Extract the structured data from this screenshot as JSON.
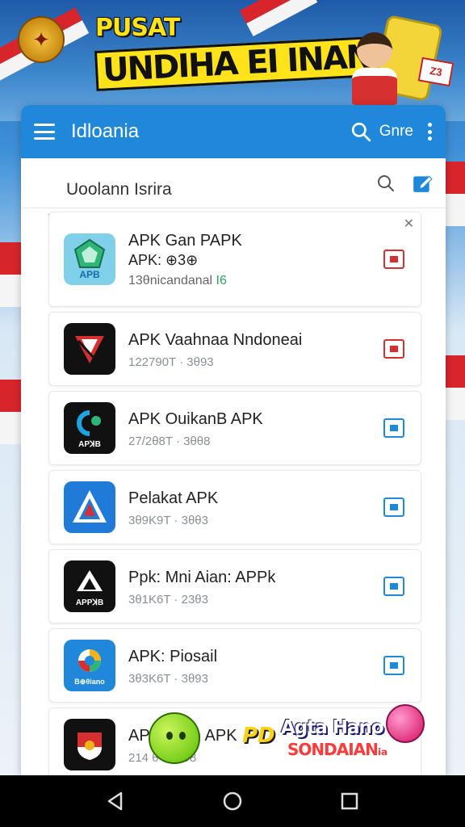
{
  "banner": {
    "title_line1": "PUSAT",
    "title_line2": "UNDIHA EI INANSIA",
    "sign_text": "Z3",
    "garuda_icon": "garuda-emblem-icon"
  },
  "appbar": {
    "title": "Idloania",
    "action_label": "Gnre",
    "icons": [
      "menu-icon",
      "search-icon",
      "more-vert-icon"
    ]
  },
  "tabs": {
    "active_label": "Uoolann Isrira"
  },
  "items": [
    {
      "name": "APK Gan PAPK",
      "name2": "APK: ⊕3⊕",
      "meta": "13θnicandanal",
      "meta_highlight": "I6",
      "icon_label": "APB",
      "icon_bg": "#35b5c9",
      "icon_fg": "#1d8a5a",
      "btn_color": "#d62f2f"
    },
    {
      "name": "APK Vaahnaa Nndoneai",
      "meta": "122790T · 3θ93",
      "icon_label": "",
      "icon_bg": "#111111",
      "icon_fg": "#d62f2f",
      "btn_color": "#d62f2f"
    },
    {
      "name": "APK OuikanB APK",
      "meta": "27/2θ8T · 3θθ8",
      "icon_label": "APꓘB",
      "icon_bg": "#111111",
      "icon_fg": "#1fa3e0",
      "btn_color": "#1f88d8"
    },
    {
      "name": "Pelakat APK",
      "meta": "3θ9K9T · 3θθ3",
      "icon_label": "",
      "icon_bg": "#1f7ad8",
      "icon_fg": "#ffffff",
      "btn_color": "#1f88d8"
    },
    {
      "name": "Ppk: Mni Aian: APPk",
      "meta": "3θ1K6T · 23θ3",
      "icon_label": "APPꓘB",
      "icon_bg": "#111111",
      "icon_fg": "#ffffff",
      "btn_color": "#1f88d8"
    },
    {
      "name": "APK: Piosail",
      "meta": "3θ3K6T · 3θ93",
      "icon_label": "B⊕θiano",
      "icon_bg": "#1f88d8",
      "icon_fg": "#ffffff",
      "btn_color": "#1f88d8"
    },
    {
      "name": "APK nann APK",
      "meta": "214 θ · 3θθ8",
      "icon_label": "",
      "icon_bg": "#111111",
      "icon_fg": "#d62f2f",
      "btn_color": "#1f88d8"
    }
  ],
  "promo": {
    "pd": "PD",
    "line1": "Agta Hano",
    "line2": "SONDAIANᵢₐ"
  },
  "navbar": {
    "icons": [
      "back-icon",
      "home-icon",
      "recents-icon"
    ]
  },
  "colors": {
    "appbar": "#1f88d8",
    "download_red": "#d62f2f",
    "download_blue": "#1f88d8"
  }
}
